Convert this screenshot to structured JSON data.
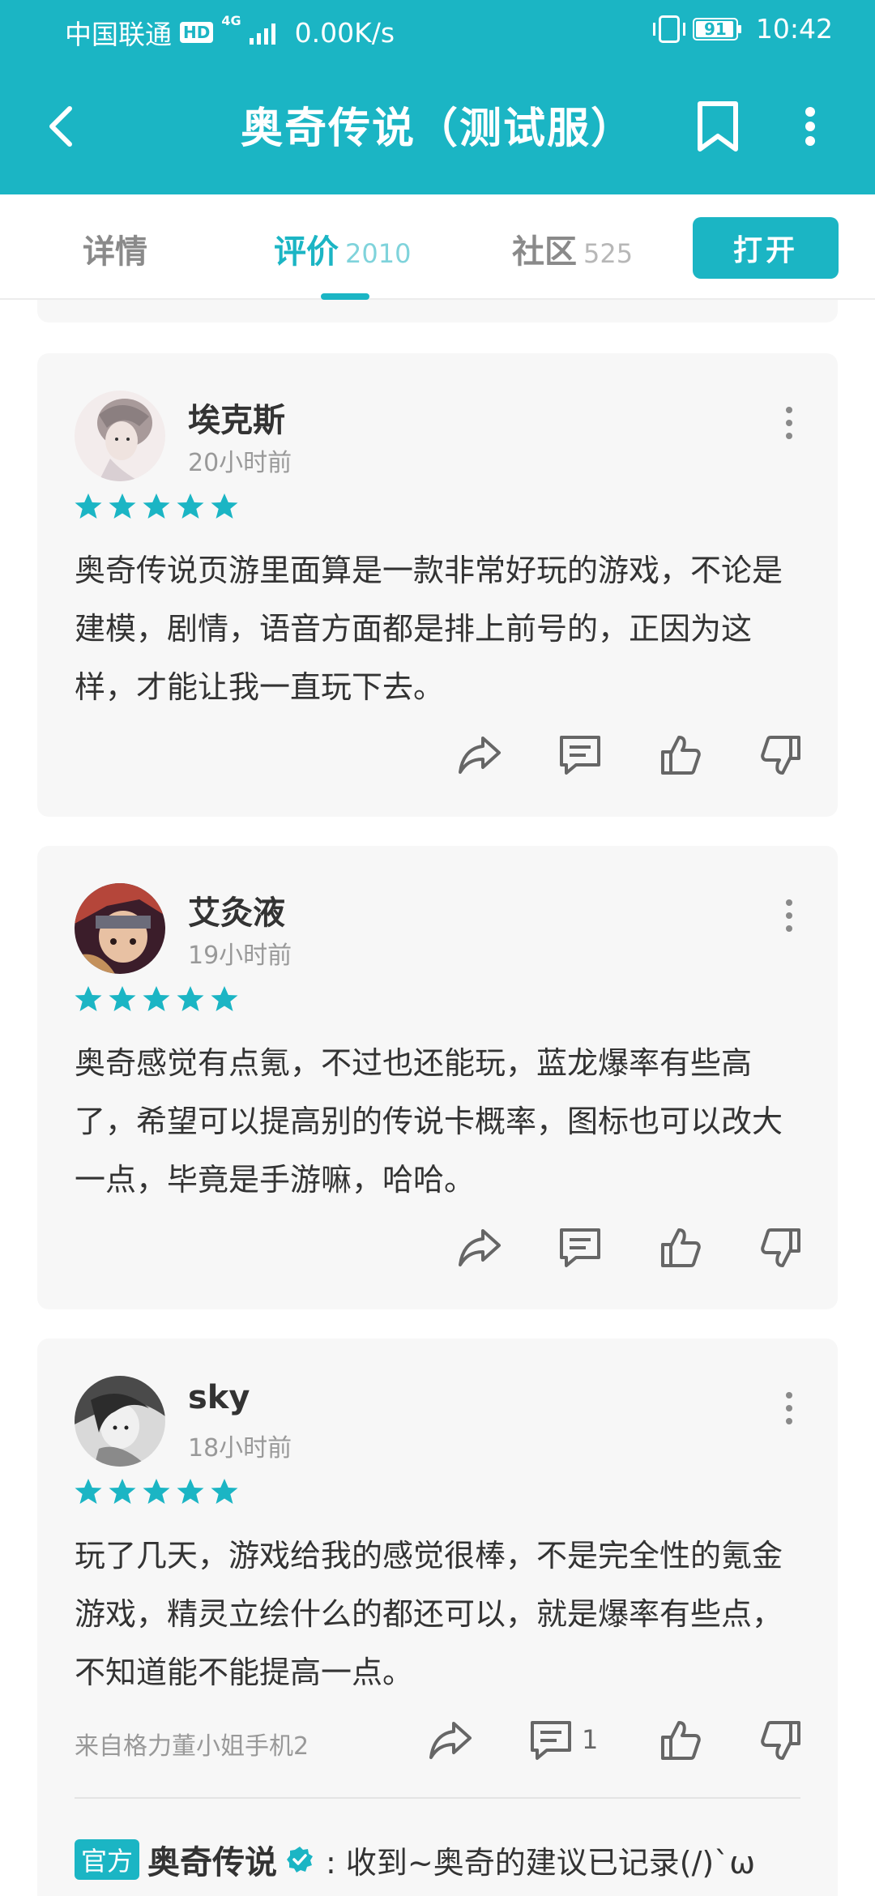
{
  "theme": {
    "accent": "#1bb5c4",
    "star_color": "#1bb5c4"
  },
  "status_bar": {
    "carrier": "中国联通",
    "hd": "HD",
    "network": "4G",
    "speed": "0.00K/s",
    "battery": "91",
    "time": "10:42"
  },
  "title_bar": {
    "back_icon": "chevron-left-icon",
    "title": "奥奇传说（测试服）",
    "bookmark_icon": "bookmark-icon",
    "more_icon": "more-vertical-icon"
  },
  "tabs": [
    {
      "label": "详情",
      "count": ""
    },
    {
      "label": "评价",
      "count": "2010",
      "active": true
    },
    {
      "label": "社区",
      "count": "525"
    }
  ],
  "open_button": "打开",
  "reviews": [
    {
      "user": "埃克斯",
      "time": "20小时前",
      "rating": 5,
      "text": "奥奇传说页游里面算是一款非常好玩的游戏，不论是建模，剧情，语音方面都是排上前号的，正因为这样，才能让我一直玩下去。"
    },
    {
      "user": "艾灸液",
      "time": "19小时前",
      "rating": 5,
      "text": "奥奇感觉有点氪，不过也还能玩，蓝龙爆率有些高了，希望可以提高别的传说卡概率，图标也可以改大一点，毕竟是手游嘛，哈哈。"
    },
    {
      "user": "sky",
      "time": "18小时前",
      "rating": 5,
      "text": "玩了几天，游戏给我的感觉很棒，不是完全性的氪金游戏，精灵立绘什么的都还可以，就是爆率有些点，不知道能不能提高一点。",
      "device": "来自格力董小姐手机2",
      "comment_count": "1",
      "reply": {
        "badge": "官方",
        "name": "奥奇传说",
        "text": ": 收到~奥奇的建议已记录(/)`ω"
      }
    }
  ]
}
